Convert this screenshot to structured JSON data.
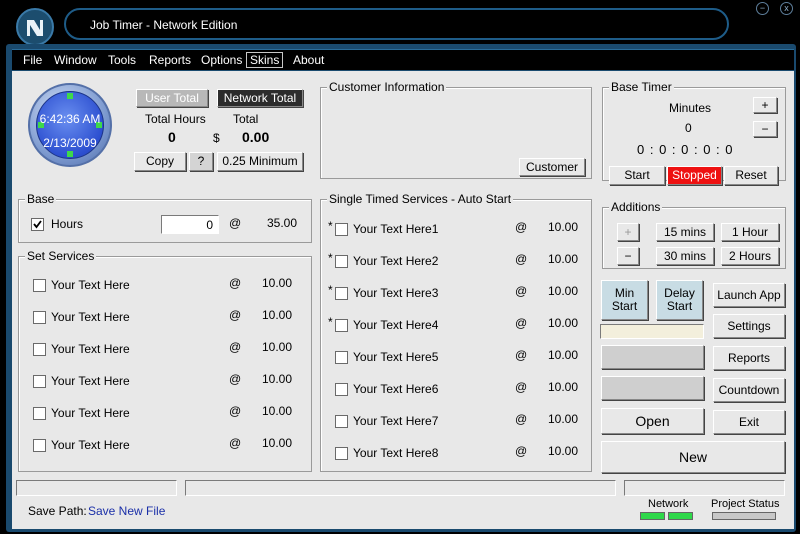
{
  "window": {
    "title": "Job Timer - Network Edition",
    "min_label": "−",
    "close_label": "x"
  },
  "menu": {
    "items": [
      "File",
      "Window",
      "Tools",
      "Reports",
      "Options",
      "Skins",
      "About"
    ]
  },
  "clock": {
    "time": "6:42:36 AM",
    "date": "2/13/2009"
  },
  "totals": {
    "user_total_label": "User Total",
    "network_total_label": "Network Total",
    "hours_label": "Total Hours",
    "total_label": "Total",
    "hours_value": "0",
    "currency": "$",
    "total_value": "0.00",
    "copy_label": "Copy",
    "help_label": "?",
    "minimum_label": "0.25 Minimum"
  },
  "customer": {
    "title": "Customer Information",
    "button": "Customer"
  },
  "base_timer": {
    "title": "Base Timer",
    "minutes_label": "Minutes",
    "plus": "+",
    "minus": "−",
    "minutes_value": "0",
    "display": "0 : 0 : 0 : 0 : 0",
    "start": "Start",
    "stopped": "Stopped",
    "reset": "Reset"
  },
  "base": {
    "title": "Base",
    "hours_label": "Hours",
    "hours_value": "0",
    "at": "@",
    "rate": "35.00"
  },
  "set_services": {
    "title": "Set Services",
    "items": [
      {
        "label": "Your Text Here",
        "at": "@",
        "rate": "10.00"
      },
      {
        "label": "Your Text Here",
        "at": "@",
        "rate": "10.00"
      },
      {
        "label": "Your Text Here",
        "at": "@",
        "rate": "10.00"
      },
      {
        "label": "Your Text Here",
        "at": "@",
        "rate": "10.00"
      },
      {
        "label": "Your Text Here",
        "at": "@",
        "rate": "10.00"
      },
      {
        "label": "Your Text Here",
        "at": "@",
        "rate": "10.00"
      }
    ]
  },
  "single_timed": {
    "title": "Single Timed Services - Auto Start",
    "items": [
      {
        "star": "*",
        "label": "Your Text Here1",
        "at": "@",
        "rate": "10.00"
      },
      {
        "star": "*",
        "label": "Your Text Here2",
        "at": "@",
        "rate": "10.00"
      },
      {
        "star": "*",
        "label": "Your Text Here3",
        "at": "@",
        "rate": "10.00"
      },
      {
        "star": "*",
        "label": "Your Text Here4",
        "at": "@",
        "rate": "10.00"
      },
      {
        "star": "",
        "label": "Your Text Here5",
        "at": "@",
        "rate": "10.00"
      },
      {
        "star": "",
        "label": "Your Text Here6",
        "at": "@",
        "rate": "10.00"
      },
      {
        "star": "",
        "label": "Your Text Here7",
        "at": "@",
        "rate": "10.00"
      },
      {
        "star": "",
        "label": "Your Text Here8",
        "at": "@",
        "rate": "10.00"
      }
    ]
  },
  "additions": {
    "title": "Additions",
    "plus": "+",
    "minus": "−",
    "b15": "15 mins",
    "b1h": "1 Hour",
    "b30": "30 mins",
    "b2h": "2 Hours"
  },
  "actions": {
    "min_start": "Min\nStart",
    "delay_start": "Delay\nStart",
    "launch_app": "Launch App",
    "settings": "Settings",
    "reports": "Reports",
    "countdown": "Countdown",
    "open": "Open",
    "exit": "Exit",
    "new": "New"
  },
  "status": {
    "save_path_label": "Save Path:",
    "save_path_value": "Save New File",
    "network_label": "Network",
    "project_status_label": "Project Status"
  }
}
